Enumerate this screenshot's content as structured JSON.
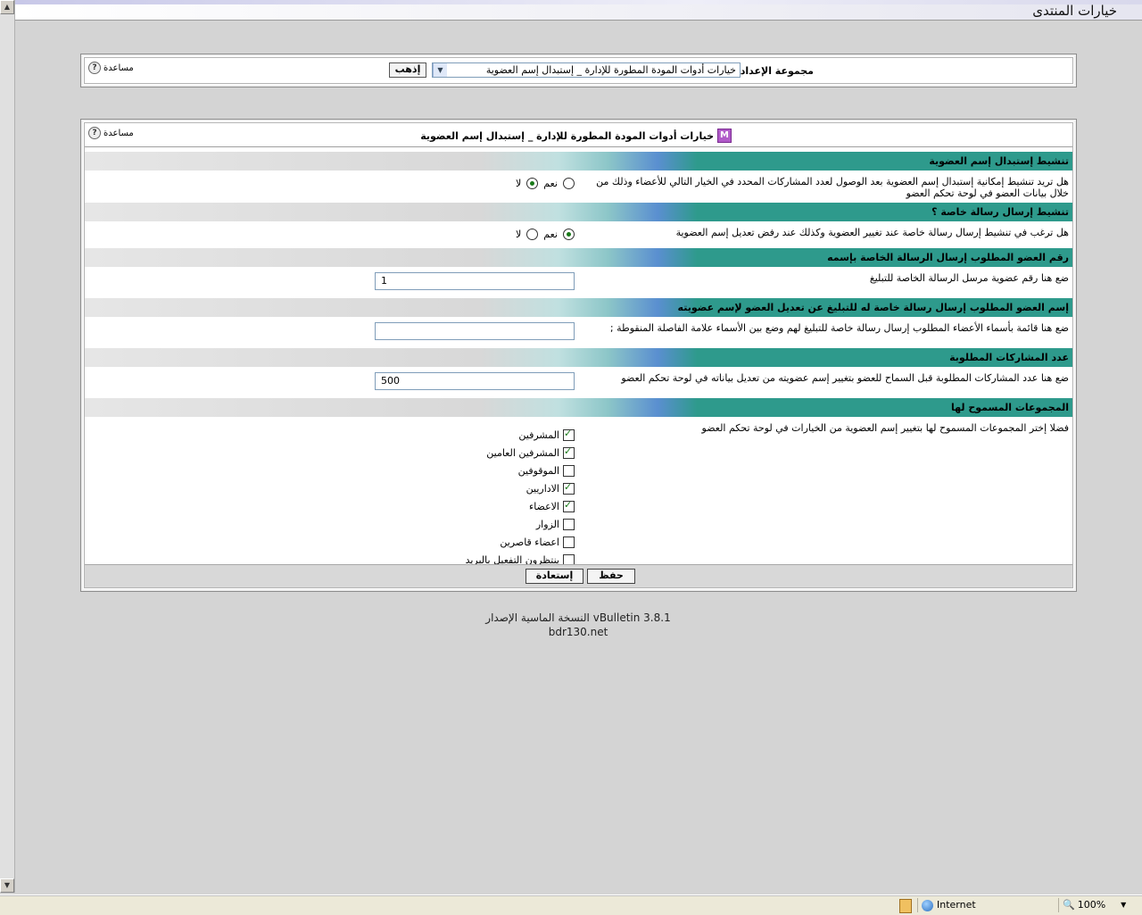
{
  "page": {
    "title": "خيارات المنتدى"
  },
  "toolbar": {
    "settings_group_label": "مجموعة الإعداد",
    "settings_group_value": "خيارات أدوات المودة المطورة للإدارة _ إستبدال إسم العضوية",
    "go_label": "إذهب",
    "help_label": "مساعدة"
  },
  "main": {
    "header_title": "خيارات أدوات المودة المطورة للإدارة _ إستبدال إسم العضوية",
    "header_icon_letter": "M",
    "help_label": "مساعدة",
    "sections": [
      {
        "title": "تنشيط إستبدال إسم العضوية",
        "description": "هل تريد تنشيط إمكانية إستبدال إسم العضوية بعد الوصول لعدد المشاركات المحدد في الخيار التالي للأعضاء وذلك من خلال بيانات العضو في لوحة تحكم العضو",
        "yes_label": "نعم",
        "no_label": "لا",
        "selected": "no"
      },
      {
        "title": "تنشيط إرسال رسالة خاصة ؟",
        "description": "هل ترغب في تنشيط إرسال رسالة خاصة عند تغيير العضوية وكذلك عند رفض تعديل إسم العضوية",
        "yes_label": "نعم",
        "no_label": "لا",
        "selected": "yes"
      },
      {
        "title": "رقم العضو المطلوب إرسال الرسالة الخاصة بإسمه",
        "description": "ضع هنا رقم عضوية مرسل الرسالة الخاصة للتبليغ",
        "value": "1"
      },
      {
        "title": "إسم العضو المطلوب إرسال رسالة خاصة له للتبليغ عن تعديل العضو لإسم عضويته",
        "description": "ضع هنا قائمة بأسماء الأعضاء المطلوب إرسال رسالة خاصة للتبليغ لهم وضع بين الأسماء علامة الفاصلة المنقوطة ;",
        "value": ""
      },
      {
        "title": "عدد المشاركات المطلوبة",
        "description": "ضع هنا عدد المشاركات المطلوبة قبل السماح للعضو بتغيير إسم عضويته من تعديل بياناته في لوحة تحكم العضو",
        "value": "500"
      },
      {
        "title": "المجموعات المسموح لها",
        "description": "فضلا إختر المجموعات المسموح لها بتغيير إسم العضوية من الخيارات في لوحة تحكم العضو",
        "groups": [
          {
            "label": "المشرفين",
            "checked": true
          },
          {
            "label": "المشرفين العامين",
            "checked": true
          },
          {
            "label": "الموقوفين",
            "checked": false
          },
          {
            "label": "الاداريين",
            "checked": true
          },
          {
            "label": "الاعضاء",
            "checked": true
          },
          {
            "label": "الزوار",
            "checked": false
          },
          {
            "label": "اعضاء قاصرين",
            "checked": false
          },
          {
            "label": "ينتظرون التفعيل بالبريد",
            "checked": false
          }
        ]
      }
    ],
    "save_label": "حفظ",
    "reset_label": "إستعادة"
  },
  "footer": {
    "version_text": "النسخة الماسية الإصدار vBulletin 3.8.1",
    "site": "bdr130.net"
  },
  "statusbar": {
    "zone": "Internet",
    "zoom": "100%"
  },
  "icons": {
    "help": "question-circle-icon",
    "header": "m-logo-icon",
    "zone": "globe-icon",
    "zoom": "magnifier-icon"
  }
}
